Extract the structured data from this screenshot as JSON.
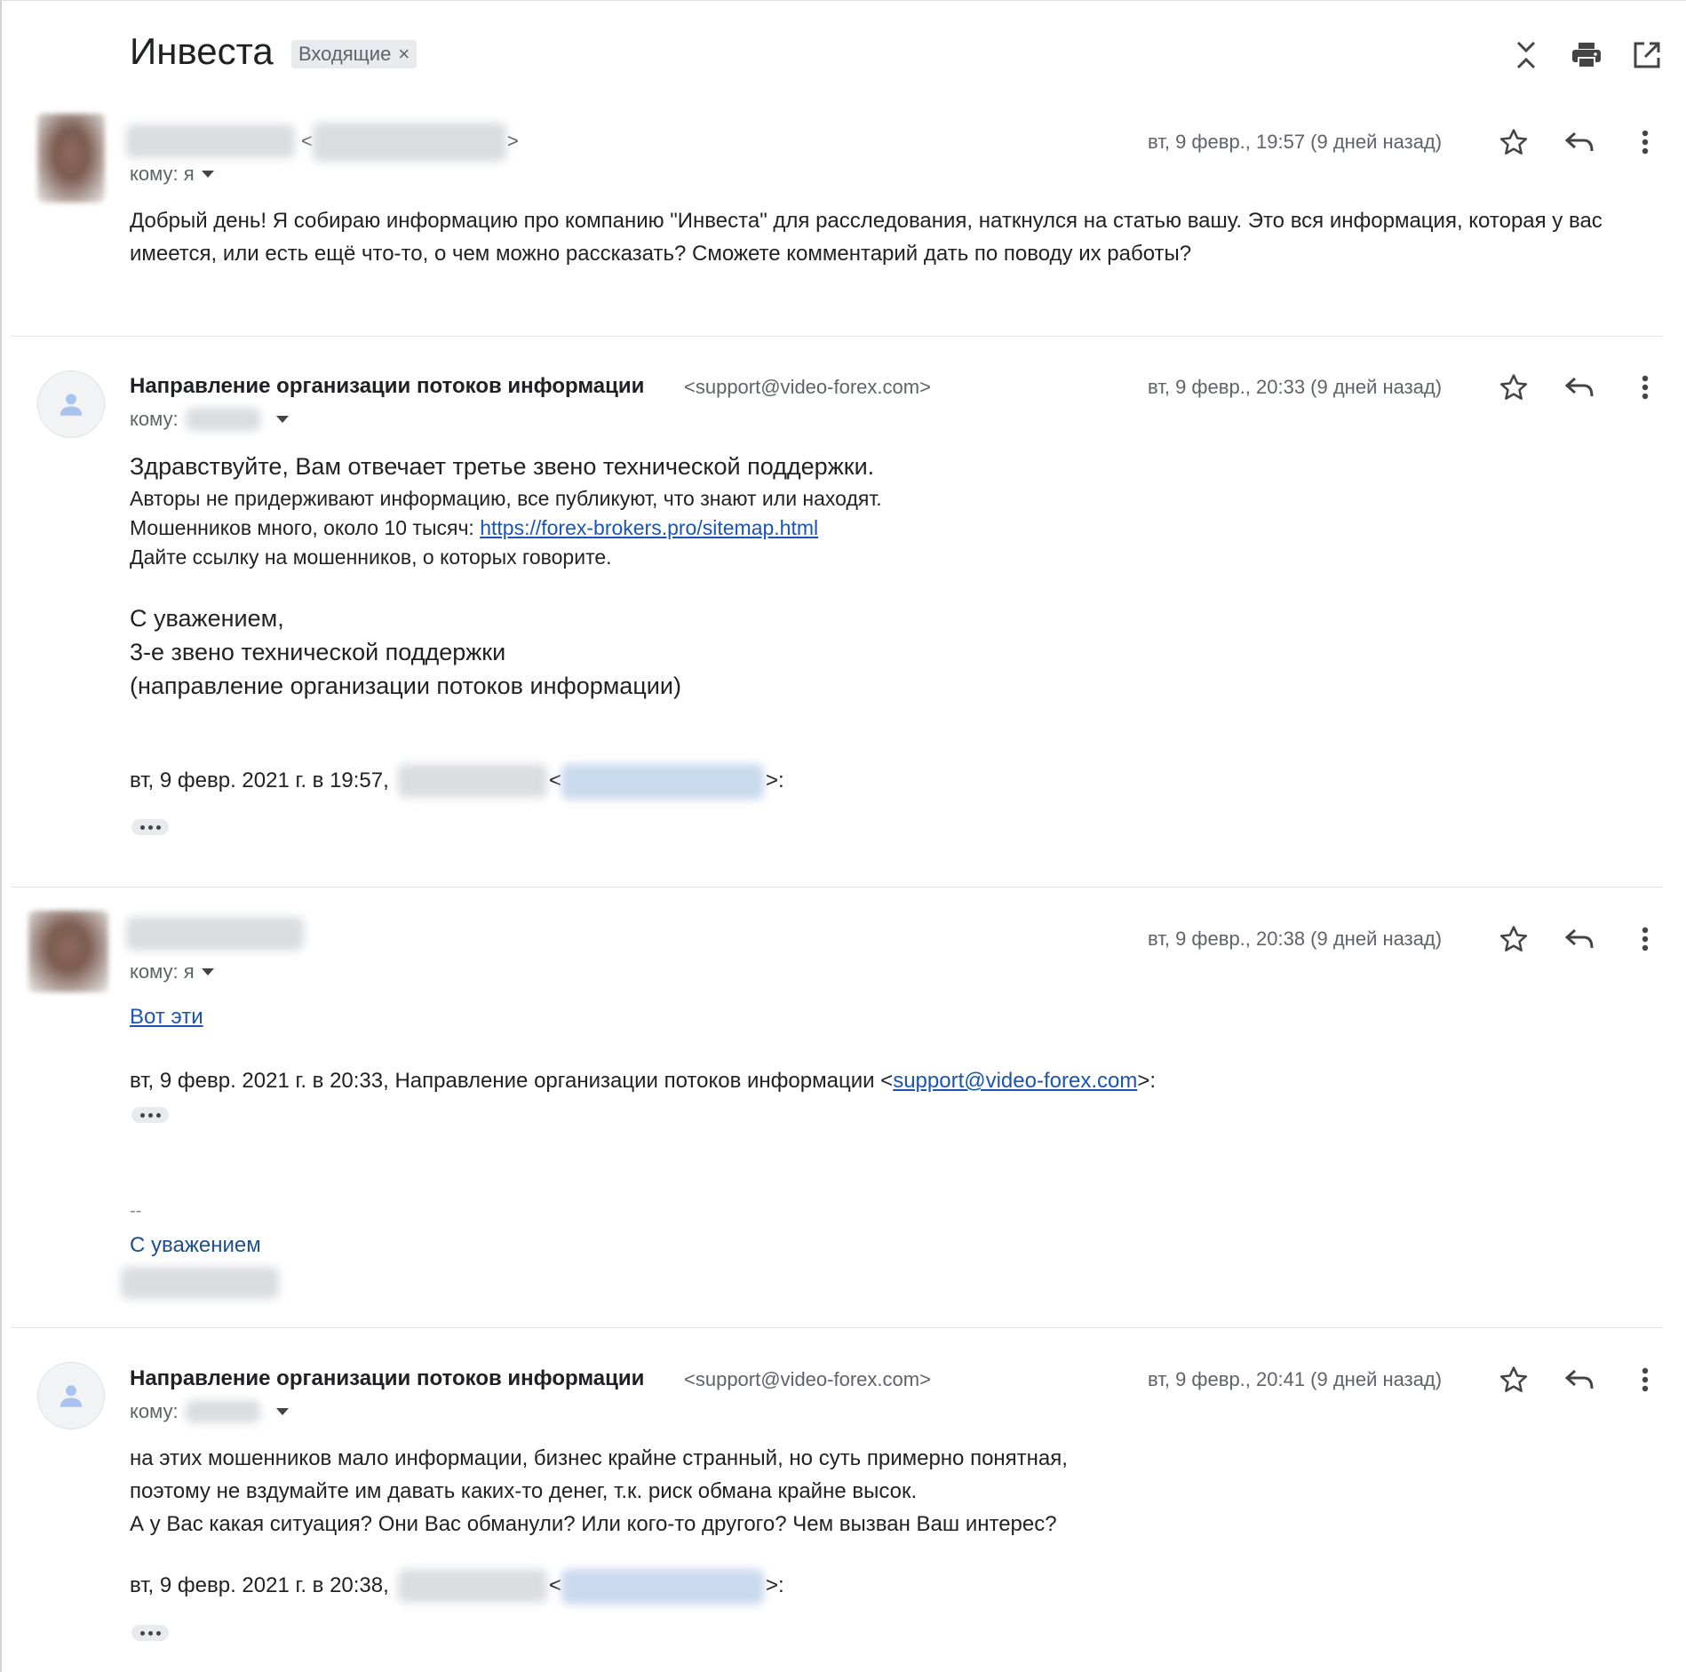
{
  "thread": {
    "subject": "Инвеста",
    "label": "Входящие",
    "label_remove": "×"
  },
  "toolbar": [
    "collapse-all-icon",
    "print-icon",
    "open-in-new-window-icon"
  ],
  "messages": [
    {
      "lt": "<",
      "gt": ">",
      "to": "кому: я",
      "date": "вт, 9 февр., 19:57 (9 дней назад)",
      "body": [
        "Добрый день! Я собираю информацию про компанию \"Инвеста\" для расследования, наткнулся на статью вашу. Это вся информация, которая у вас",
        "имеется, или есть ещё что-то, о чем можно рассказать? Сможете комментарий дать по поводу их работы?"
      ]
    },
    {
      "sender": "Направление организации потоков информации",
      "email": "<support@video-forex.com>",
      "to": "кому:",
      "date": "вт, 9 февр., 20:33 (9 дней назад)",
      "greeting": "Здравствуйте, Вам отвечает третье звено технической поддержки.",
      "line1": "Авторы не придерживают информацию, все публикуют, что знают или находят.",
      "line2_prefix": "Мошенников много, около 10 тысяч: ",
      "line2_link": "https://forex-brokers.pro/sitemap.html",
      "line3": "Дайте ссылку на мошенников, о которых говорите.",
      "sign1": "С уважением,",
      "sign2": "3-е звено технической поддержки",
      "sign3": "(направление организации потоков информации)",
      "quote_prefix": "вт, 9 февр. 2021 г. в 19:57,",
      "quote_lt": "<",
      "quote_gt": ">:"
    },
    {
      "to": "кому: я",
      "date": "вт, 9 февр., 20:38 (9 дней назад)",
      "link": "Вот эти",
      "quote_prefix": "вт, 9 февр. 2021 г. в 20:33, Направление организации потоков информации <",
      "quote_link": "support@video-forex.com",
      "quote_suffix": ">:",
      "sig_dash": "--",
      "sig": "С уважением"
    },
    {
      "sender": "Направление организации потоков информации",
      "email": "<support@video-forex.com>",
      "to": "кому:",
      "date": "вт, 9 февр., 20:41 (9 дней назад)",
      "body": [
        "на этих мошенников мало информации, бизнес крайне странный, но суть примерно понятная,",
        "поэтому не вздумайте им давать каких-то денег, т.к. риск обмана крайне высок.",
        "А у Вас какая ситуация? Они Вас обманули? Или кого-то другого? Чем вызван Ваш интерес?"
      ],
      "quote_prefix": "вт, 9 февр. 2021 г. в 20:38,",
      "quote_lt": "<",
      "quote_gt": ">:"
    }
  ],
  "message_actions": [
    "star-icon",
    "reply-icon",
    "more-options-icon"
  ]
}
